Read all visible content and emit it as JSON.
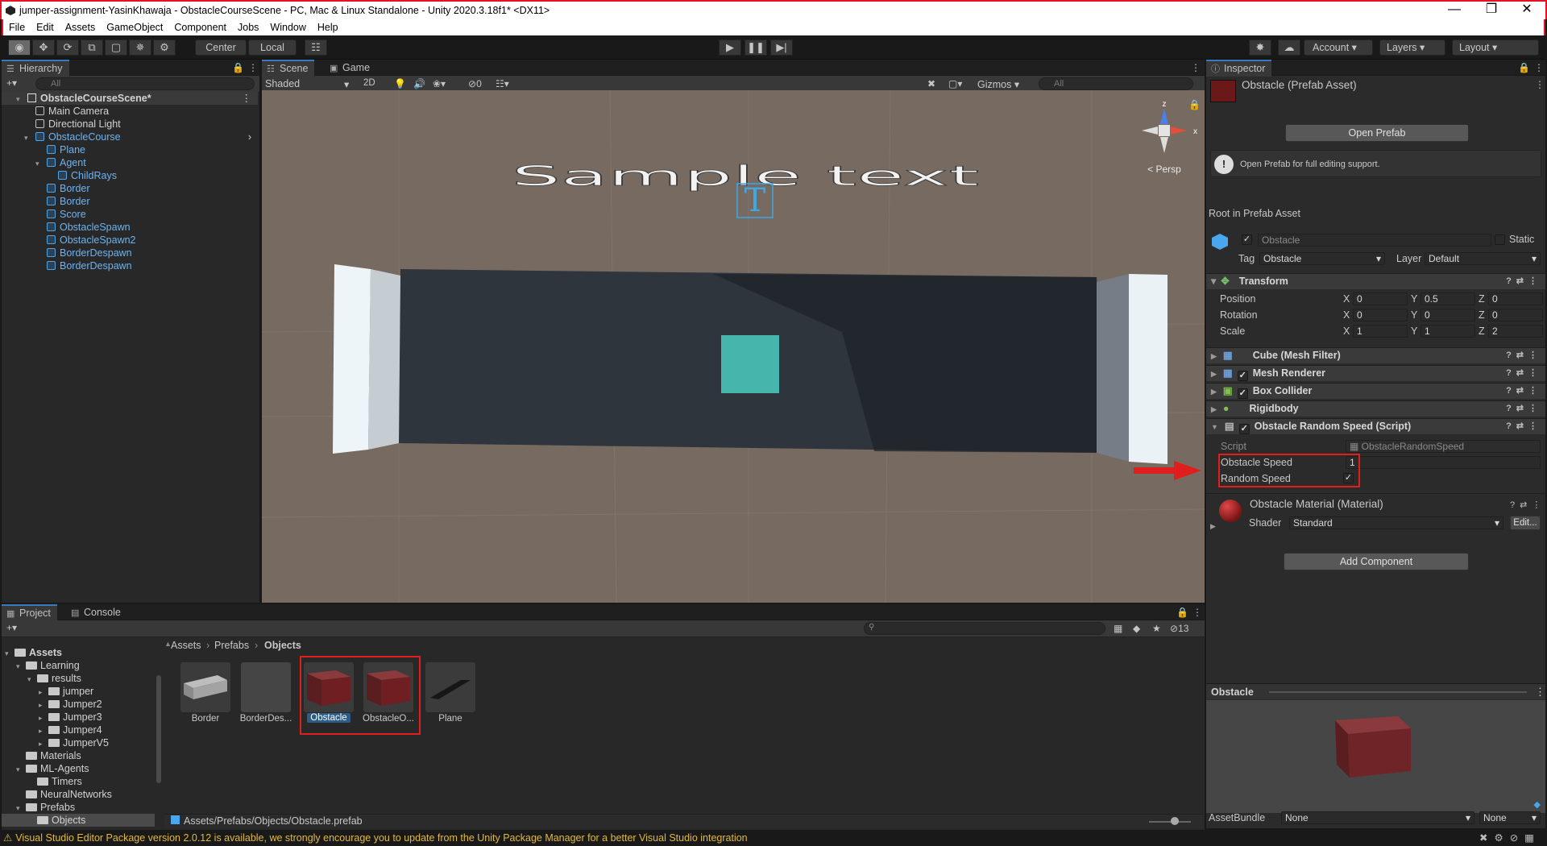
{
  "window": {
    "title": "jumper-assignment-YasinKhawaja - ObstacleCourseScene - PC, Mac & Linux Standalone - Unity 2020.3.18f1* <DX11>"
  },
  "menu": [
    "File",
    "Edit",
    "Assets",
    "GameObject",
    "Component",
    "Jobs",
    "Window",
    "Help"
  ],
  "toolbar": {
    "pivot": "Center",
    "space": "Local",
    "account": "Account",
    "layers": "Layers",
    "layout": "Layout"
  },
  "hierarchy": {
    "tab": "Hierarchy",
    "search_placeholder": "All",
    "items": [
      {
        "label": "ObstacleCourseScene*",
        "indent": 0,
        "type": "scene"
      },
      {
        "label": "Main Camera",
        "indent": 1,
        "type": "obj"
      },
      {
        "label": "Directional Light",
        "indent": 1,
        "type": "obj"
      },
      {
        "label": "ObstacleCourse",
        "indent": 1,
        "type": "prefab"
      },
      {
        "label": "Plane",
        "indent": 2,
        "type": "prefab"
      },
      {
        "label": "Agent",
        "indent": 2,
        "type": "prefab"
      },
      {
        "label": "ChildRays",
        "indent": 3,
        "type": "prefab"
      },
      {
        "label": "Border",
        "indent": 2,
        "type": "prefab"
      },
      {
        "label": "Border",
        "indent": 2,
        "type": "prefab"
      },
      {
        "label": "Score",
        "indent": 2,
        "type": "prefab"
      },
      {
        "label": "ObstacleSpawn",
        "indent": 2,
        "type": "prefab"
      },
      {
        "label": "ObstacleSpawn2",
        "indent": 2,
        "type": "prefab"
      },
      {
        "label": "BorderDespawn",
        "indent": 2,
        "type": "prefab"
      },
      {
        "label": "BorderDespawn",
        "indent": 2,
        "type": "prefab"
      }
    ]
  },
  "scene": {
    "tabs": [
      "Scene",
      "Game"
    ],
    "shading": "Shaded",
    "mode_2d": "2D",
    "hidden_count": "0",
    "gizmos": "Gizmos",
    "search_placeholder": "All",
    "sample_text": "Sample text",
    "persp": "< Persp",
    "axis_x": "x",
    "axis_z": "z"
  },
  "inspector": {
    "tab": "Inspector",
    "asset_title": "Obstacle (Prefab Asset)",
    "open_prefab": "Open Prefab",
    "info": "Open Prefab for full editing support.",
    "root_label": "Root in Prefab Asset",
    "name": "Obstacle",
    "static_label": "Static",
    "tag_label": "Tag",
    "tag_value": "Obstacle",
    "layer_label": "Layer",
    "layer_value": "Default",
    "transform": {
      "title": "Transform",
      "rows": [
        {
          "label": "Position",
          "x": "0",
          "y": "0.5",
          "z": "0"
        },
        {
          "label": "Rotation",
          "x": "0",
          "y": "0",
          "z": "0"
        },
        {
          "label": "Scale",
          "x": "1",
          "y": "1",
          "z": "2"
        }
      ]
    },
    "components": [
      "Cube (Mesh Filter)",
      "Mesh Renderer",
      "Box Collider",
      "Rigidbody",
      "Obstacle Random Speed (Script)"
    ],
    "script_label": "Script",
    "script_value": "ObstacleRandomSpeed",
    "obstacle_speed_label": "Obstacle Speed",
    "obstacle_speed_value": "1",
    "random_speed_label": "Random Speed",
    "random_speed_checked": true,
    "material_title": "Obstacle Material (Material)",
    "shader_label": "Shader",
    "shader_value": "Standard",
    "edit_label": "Edit...",
    "add_component": "Add Component",
    "preview_title": "Obstacle",
    "assetbundle_label": "AssetBundle",
    "assetbundle_value": "None",
    "assetbundle_variant": "None"
  },
  "project": {
    "tabs": [
      "Project",
      "Console"
    ],
    "hidden_count": "13",
    "breadcrumb": [
      "Assets",
      "Prefabs",
      "Objects"
    ],
    "tree": [
      {
        "label": "Assets",
        "indent": 0,
        "open": true
      },
      {
        "label": "Learning",
        "indent": 1,
        "open": true
      },
      {
        "label": "results",
        "indent": 2,
        "open": true
      },
      {
        "label": "jumper",
        "indent": 3,
        "open": false
      },
      {
        "label": "Jumper2",
        "indent": 3,
        "open": false
      },
      {
        "label": "Jumper3",
        "indent": 3,
        "open": false
      },
      {
        "label": "Jumper4",
        "indent": 3,
        "open": false
      },
      {
        "label": "JumperV5",
        "indent": 3,
        "open": false
      },
      {
        "label": "Materials",
        "indent": 1,
        "open": null
      },
      {
        "label": "ML-Agents",
        "indent": 1,
        "open": true
      },
      {
        "label": "Timers",
        "indent": 2,
        "open": null
      },
      {
        "label": "NeuralNetworks",
        "indent": 1,
        "open": null
      },
      {
        "label": "Prefabs",
        "indent": 1,
        "open": true
      },
      {
        "label": "Objects",
        "indent": 2,
        "open": null
      }
    ],
    "assets": [
      "Border",
      "BorderDes...",
      "Obstacle",
      "ObstacleO...",
      "Plane"
    ],
    "path": "Assets/Prefabs/Objects/Obstacle.prefab"
  },
  "status": {
    "message": "Visual Studio Editor Package version 2.0.12 is available, we strongly encourage you to update from the Unity Package Manager for a better Visual Studio integration"
  },
  "colors": {
    "highlight": "#e01e1e",
    "selection": "#2c5d87",
    "obstacle": "#7a1c1c",
    "agent": "#46b6ad"
  }
}
